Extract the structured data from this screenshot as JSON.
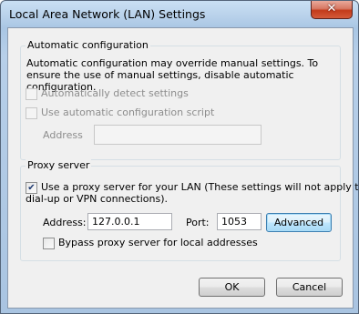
{
  "window": {
    "title": "Local Area Network (LAN) Settings",
    "close_label": "✕"
  },
  "automatic": {
    "group_title": "Automatic configuration",
    "description": "Automatic configuration may override manual settings.  To ensure the use of manual settings, disable automatic configuration.",
    "detect_label": "Automatically detect settings",
    "detect_checked": false,
    "script_label": "Use automatic configuration script",
    "script_checked": false,
    "address_label": "Address",
    "address_value": ""
  },
  "proxy": {
    "group_title": "Proxy server",
    "use_proxy_line1": "Use a proxy server for your LAN (These settings will not apply to",
    "use_proxy_line2": "dial-up or VPN connections).",
    "use_proxy_checked": true,
    "address_label": "Address:",
    "address_value": "127.0.0.1",
    "port_label": "Port:",
    "port_value": "1053",
    "advanced_label": "Advanced",
    "bypass_label": "Bypass proxy server for local addresses",
    "bypass_checked": false
  },
  "buttons": {
    "ok_label": "OK",
    "cancel_label": "Cancel"
  }
}
